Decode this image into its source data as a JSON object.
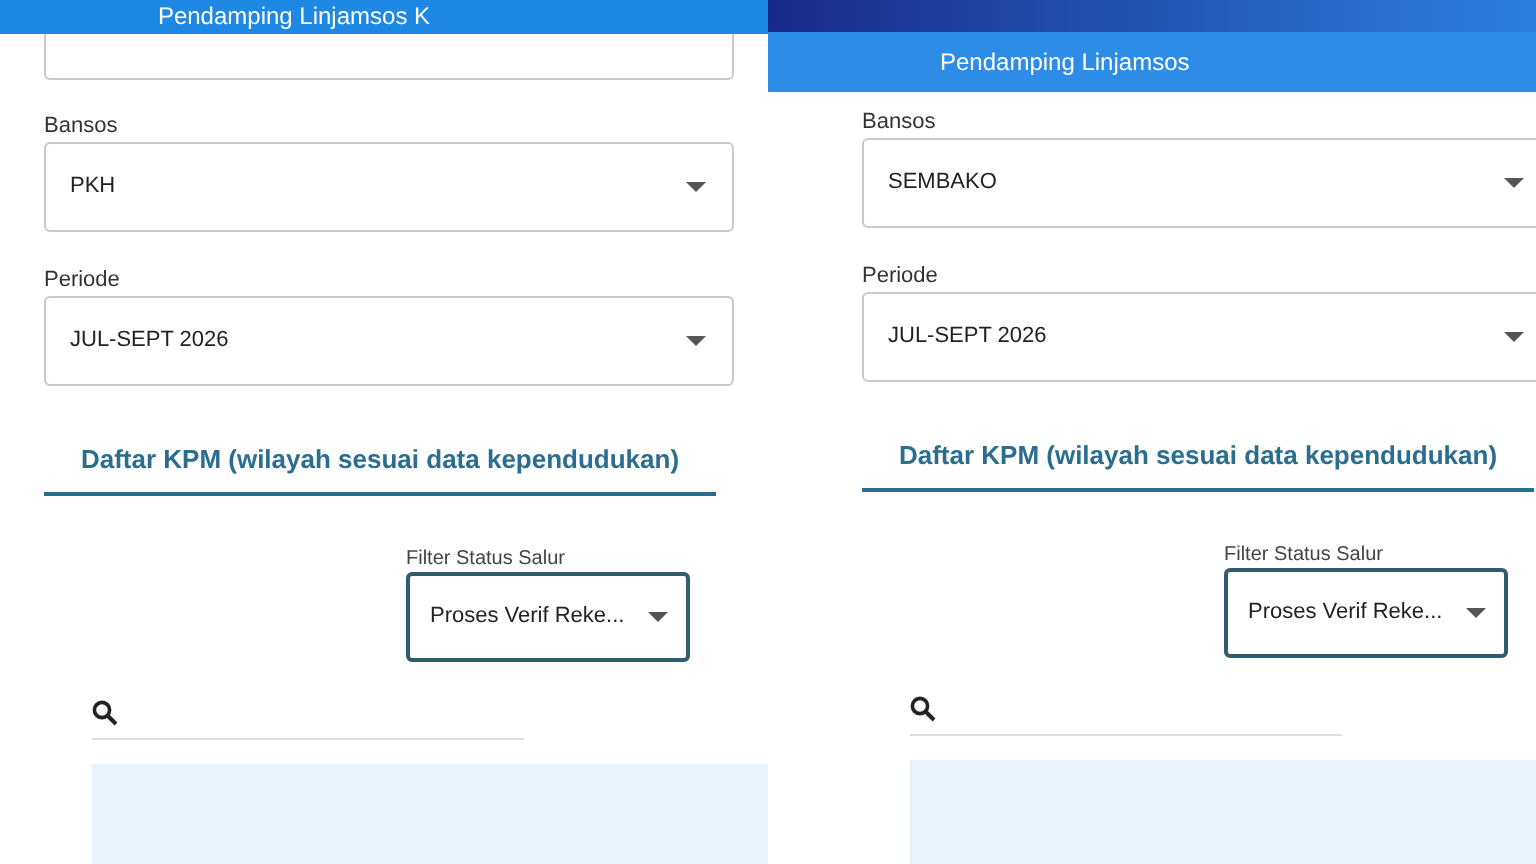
{
  "panels": [
    {
      "kind": "scrolled",
      "title": "Pendamping Linjamsos K",
      "fields": [
        {
          "label": "Bansos",
          "value": "PKH"
        },
        {
          "label": "Periode",
          "value": "JUL-SEPT 2026"
        }
      ],
      "tab": "Daftar KPM (wilayah sesuai data kependudukan)",
      "filter": {
        "label": "Filter Status Salur",
        "value": "Proses Verif Reke..."
      }
    },
    {
      "kind": "top",
      "title": "Pendamping Linjamsos",
      "fields": [
        {
          "label": "Bansos",
          "value": "SEMBAKO"
        },
        {
          "label": "Periode",
          "value": "JUL-SEPT 2026"
        }
      ],
      "tab": "Daftar KPM (wilayah sesuai data kependudukan)",
      "filter": {
        "label": "Filter Status Salur",
        "value": "Proses Verif Reke..."
      }
    }
  ]
}
